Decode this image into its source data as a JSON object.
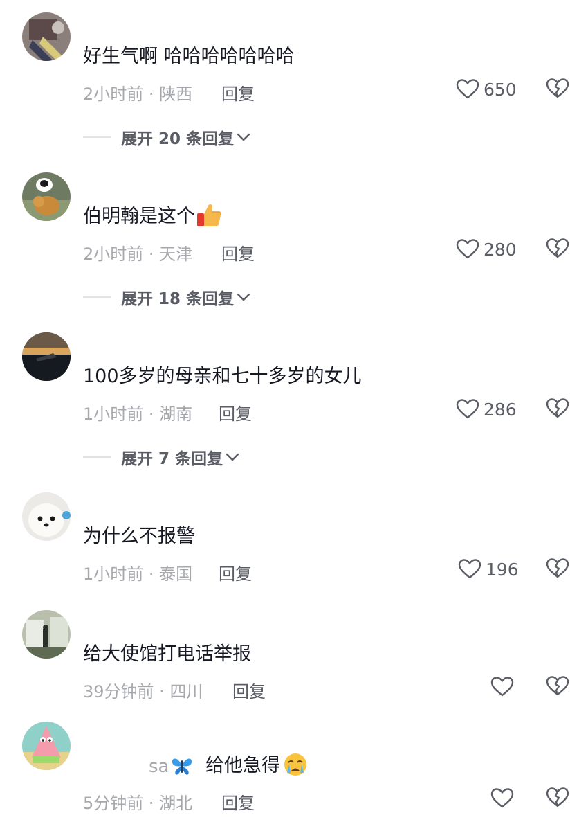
{
  "comments": [
    {
      "username": "",
      "text": "好生气啊 哈哈哈哈哈哈哈",
      "time": "2小时前",
      "location": "陕西",
      "reply": "回复",
      "likes": "650",
      "expand": "展开 20 条回复"
    },
    {
      "username": "",
      "text": "伯明翰是这个",
      "emoji": "thumbs-up-icon",
      "time": "2小时前",
      "location": "天津",
      "reply": "回复",
      "likes": "280",
      "expand": "展开 18 条回复"
    },
    {
      "username": "",
      "text": "100多岁的母亲和七十多岁的女儿",
      "time": "1小时前",
      "location": "湖南",
      "reply": "回复",
      "likes": "286",
      "expand": "展开 7 条回复"
    },
    {
      "username": "",
      "text": "为什么不报警",
      "time": "1小时前",
      "location": "泰国",
      "reply": "回复",
      "likes": "196"
    },
    {
      "username": "",
      "text": "给大使馆打电话举报",
      "time": "39分钟前",
      "location": "四川",
      "reply": "回复",
      "likes": ""
    },
    {
      "username": "sa",
      "username_emoji": "butterfly-icon",
      "text": "给他急得",
      "emoji": "crying-face-icon",
      "time": "5分钟前",
      "location": "湖北",
      "reply": "回复",
      "likes": ""
    }
  ],
  "separator": " · ",
  "icons": {
    "like": "heart-outline-icon",
    "dislike": "broken-heart-icon",
    "expand": "chevron-down-icon"
  },
  "colors": {
    "primary_text": "#161823",
    "secondary_text": "#a7a8ad",
    "action_text": "#5b5d66",
    "icon": "#5b5d66"
  }
}
